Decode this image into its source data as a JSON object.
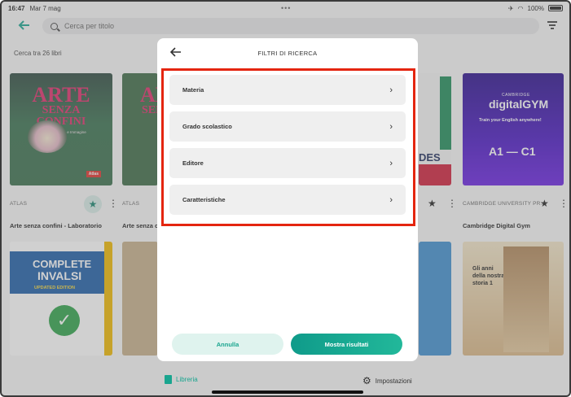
{
  "status": {
    "time": "16:47",
    "date": "Mar 7 mag",
    "battery": "100%"
  },
  "search": {
    "placeholder": "Cerca per titolo"
  },
  "results": {
    "count_label": "Cerca tra 26 libri"
  },
  "books": [
    {
      "publisher": "ATLAS",
      "title": "Arte senza confini - Laboratorio",
      "favorite": true
    },
    {
      "publisher": "ATLAS",
      "title": "Arte senza c"
    },
    {
      "publisher": "CAMBRIDGE UNIVERSITY PR...",
      "title": "Cambridge Digital Gym",
      "favorite": false
    }
  ],
  "covers": {
    "arte": {
      "line1": "ARTE",
      "line2": "SENZA",
      "line3": "CONFINI",
      "subtitle": "Laboratorio di Arte e Immagine",
      "badge": "Atlas"
    },
    "arte2": {
      "line1": "ART",
      "line2": "SEN"
    },
    "digital": {
      "brand": "CAMBRIDGE",
      "name": "digitalGYM",
      "tagline": "Train your English anywhere!",
      "level": "A1 — C1"
    },
    "complete": {
      "line1": "COMPLETE",
      "line2": "INVALSI",
      "edition": "UPDATED EDITION"
    },
    "storia": {
      "line1": "Gli anni",
      "line2": "della nostra",
      "line3": "storia 1"
    },
    "dues": {
      "text": "DES"
    }
  },
  "modal": {
    "title": "FILTRI DI RICERCA",
    "filters": [
      {
        "label": "Materia"
      },
      {
        "label": "Grado scolastico"
      },
      {
        "label": "Editore"
      },
      {
        "label": "Caratteristiche"
      }
    ],
    "cancel_label": "Annulla",
    "show_label": "Mostra risultati"
  },
  "tabbar": {
    "library_label": "Libreria",
    "settings_label": "Impostazioni"
  },
  "colors": {
    "accent": "#1aa58f",
    "highlight": "#e4250f"
  }
}
